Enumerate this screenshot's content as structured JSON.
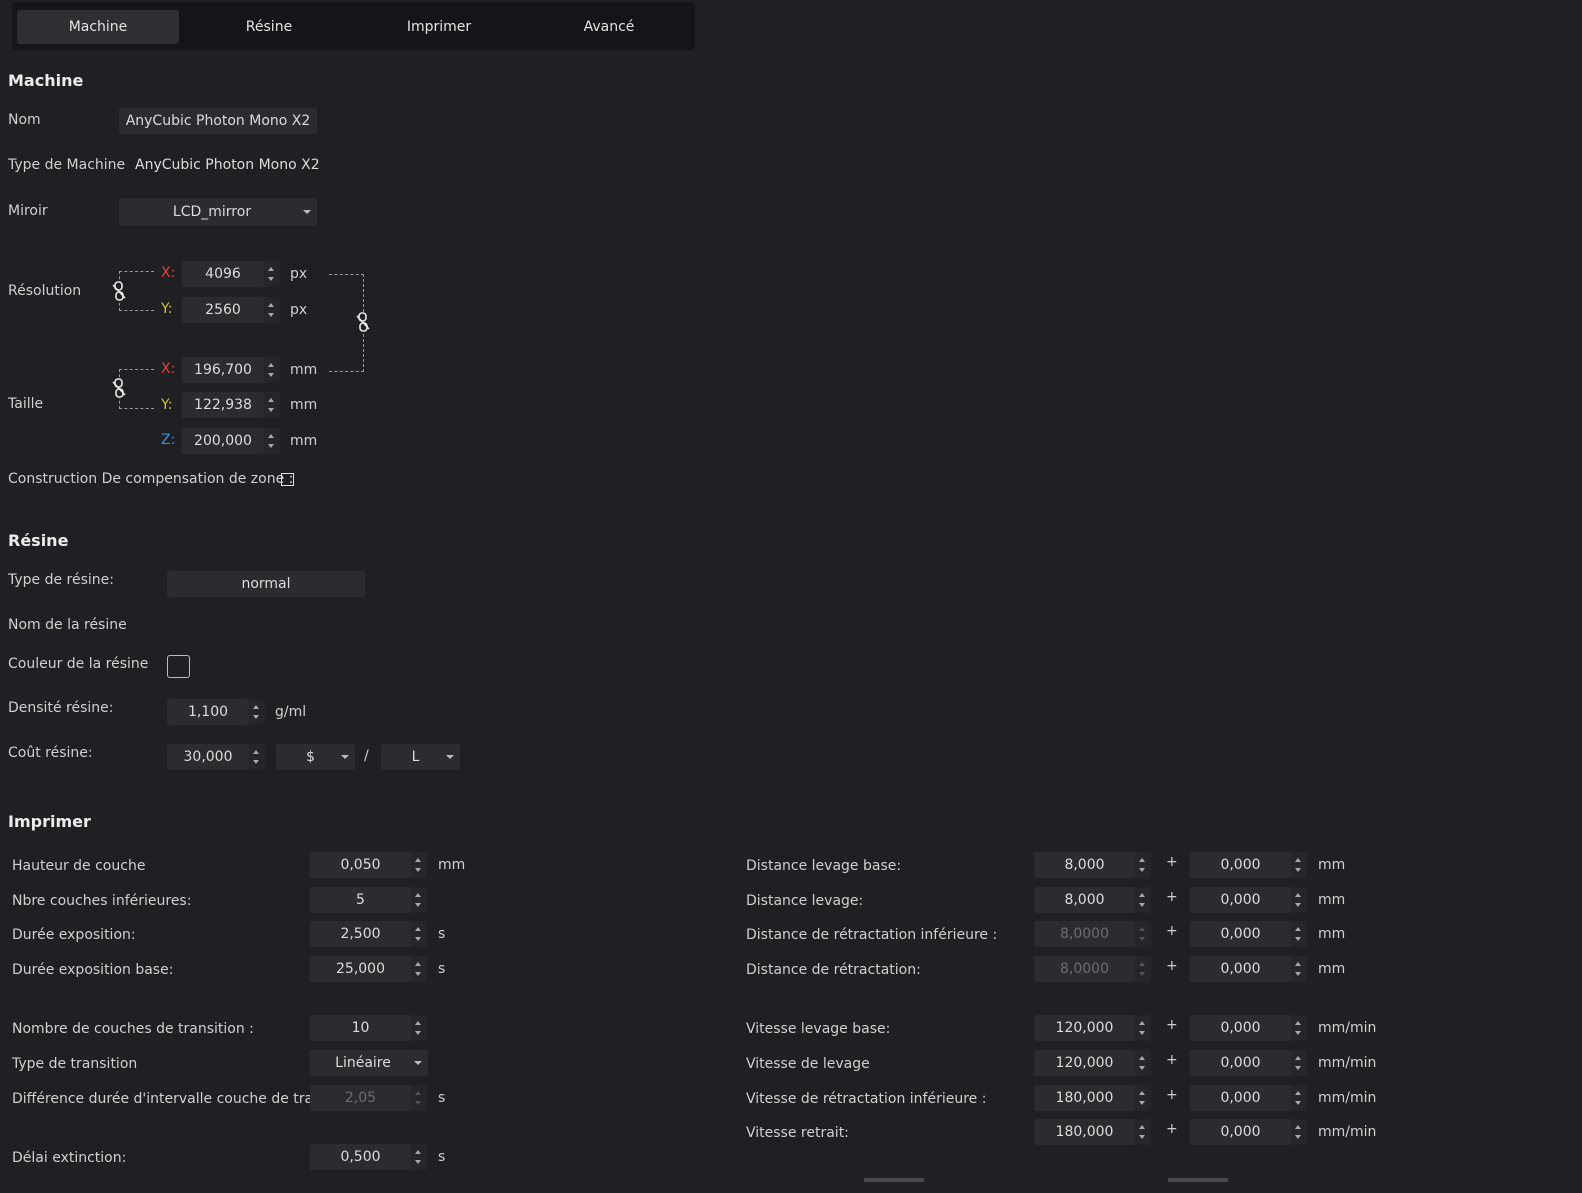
{
  "tabs": [
    "Machine",
    "Résine",
    "Imprimer",
    "Avancé"
  ],
  "machine": {
    "title": "Machine",
    "name_label": "Nom",
    "name_value": "AnyCubic Photon Mono X2",
    "type_label": "Type de Machine",
    "type_value": "AnyCubic Photon Mono X2",
    "mirror_label": "Miroir",
    "mirror_value": "LCD_mirror",
    "resolution_label": "Résolution",
    "size_label": "Taille",
    "axis_x": "X:",
    "axis_y": "Y:",
    "axis_z": "Z:",
    "res_x": "4096",
    "res_y": "2560",
    "unit_px": "px",
    "size_x": "196,700",
    "size_y": "122,938",
    "size_z": "200,000",
    "unit_mm": "mm",
    "zone_comp_label": "Construction De compensation de zone :",
    "zone_comp_checked": false
  },
  "resin": {
    "title": "Résine",
    "type_label": "Type de résine:",
    "type_value": "normal",
    "name_label": "Nom de la résine",
    "color_label": "Couleur de la résine",
    "density_label": "Densité résine:",
    "density_value": "1,100",
    "density_unit": "g/ml",
    "cost_label": "Coût résine:",
    "cost_value": "30,000",
    "currency": "$",
    "slash": "/",
    "volume_unit": "L"
  },
  "print": {
    "title": "Imprimer",
    "left": [
      {
        "label": "Hauteur de couche",
        "value": "0,050",
        "unit": "mm",
        "disabled": false
      },
      {
        "label": "Nbre couches inférieures:",
        "value": "5",
        "unit": "",
        "disabled": false
      },
      {
        "label": "Durée exposition:",
        "value": "2,500",
        "unit": "s",
        "disabled": false
      },
      {
        "label": "Durée exposition base:",
        "value": "25,000",
        "unit": "s",
        "disabled": false
      },
      {
        "label": "Nombre de couches de transition :",
        "value": "10",
        "unit": "",
        "disabled": false
      },
      {
        "label": "Type de transition",
        "value": "Linéaire",
        "unit": "",
        "disabled": false
      },
      {
        "label": "Différence durée d'intervalle couche de transit...",
        "value": "2,05",
        "unit": "s",
        "disabled": true
      },
      {
        "label": "Délai extinction:",
        "value": "0,500",
        "unit": "s",
        "disabled": false
      }
    ],
    "right": [
      {
        "label": "Distance levage base:",
        "value": "8,000",
        "plus": "+",
        "value2": "0,000",
        "unit": "mm",
        "disabled": false
      },
      {
        "label": "Distance levage:",
        "value": "8,000",
        "plus": "+",
        "value2": "0,000",
        "unit": "mm",
        "disabled": false
      },
      {
        "label": "Distance de rétractation inférieure :",
        "value": "8,0000",
        "plus": "+",
        "value2": "0,000",
        "unit": "mm",
        "disabled": true
      },
      {
        "label": "Distance de rétractation:",
        "value": "8,0000",
        "plus": "+",
        "value2": "0,000",
        "unit": "mm",
        "disabled": true
      },
      {
        "label": "Vitesse levage base:",
        "value": "120,000",
        "plus": "+",
        "value2": "0,000",
        "unit": "mm/min",
        "disabled": false
      },
      {
        "label": "Vitesse de levage",
        "value": "120,000",
        "plus": "+",
        "value2": "0,000",
        "unit": "mm/min",
        "disabled": false
      },
      {
        "label": "Vitesse de rétractation inférieure :",
        "value": "180,000",
        "plus": "+",
        "value2": "0,000",
        "unit": "mm/min",
        "disabled": false
      },
      {
        "label": "Vitesse retrait:",
        "value": "180,000",
        "plus": "+",
        "value2": "0,000",
        "unit": "mm/min",
        "disabled": false
      }
    ]
  },
  "colors": {
    "axis_x": "#e0433a",
    "axis_y": "#e0c23a",
    "axis_z": "#3a8ee0"
  }
}
